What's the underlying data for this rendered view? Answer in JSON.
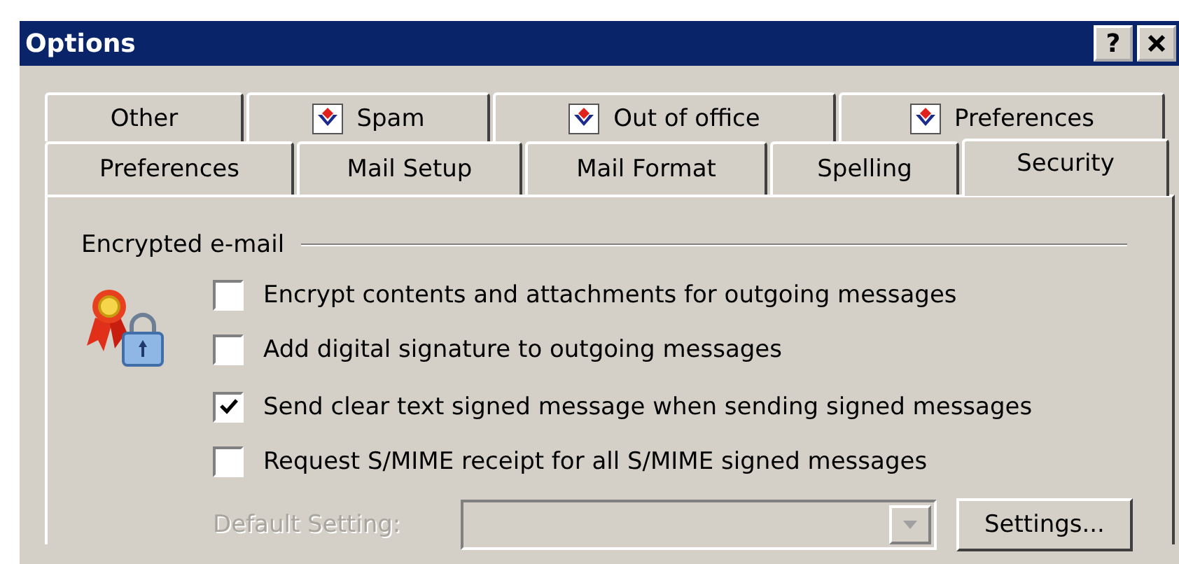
{
  "window": {
    "title": "Options",
    "help_button": "?"
  },
  "tab_rows": [
    [
      {
        "label": "Other",
        "kind": "plain",
        "selected": false
      },
      {
        "label": "Spam",
        "kind": "addin",
        "selected": false
      },
      {
        "label": "Out of office",
        "kind": "addin",
        "selected": false
      },
      {
        "label": "Preferences",
        "kind": "addin",
        "selected": false
      }
    ],
    [
      {
        "label": "Preferences",
        "kind": "plain",
        "selected": false
      },
      {
        "label": "Mail Setup",
        "kind": "plain",
        "selected": false
      },
      {
        "label": "Mail Format",
        "kind": "plain",
        "selected": false
      },
      {
        "label": "Spelling",
        "kind": "plain",
        "selected": false
      },
      {
        "label": "Security",
        "kind": "plain",
        "selected": true
      }
    ]
  ],
  "section": {
    "title": "Encrypted e-mail",
    "options": [
      {
        "label": "Encrypt contents and attachments for outgoing messages",
        "checked": false
      },
      {
        "label": "Add digital signature to outgoing messages",
        "checked": false
      },
      {
        "label": "Send clear text signed message when sending signed messages",
        "checked": true
      },
      {
        "label": "Request S/MIME receipt for all S/MIME signed messages",
        "checked": false
      }
    ],
    "default_setting": {
      "label": "Default Setting:",
      "disabled": true
    },
    "settings_button": "Settings..."
  }
}
